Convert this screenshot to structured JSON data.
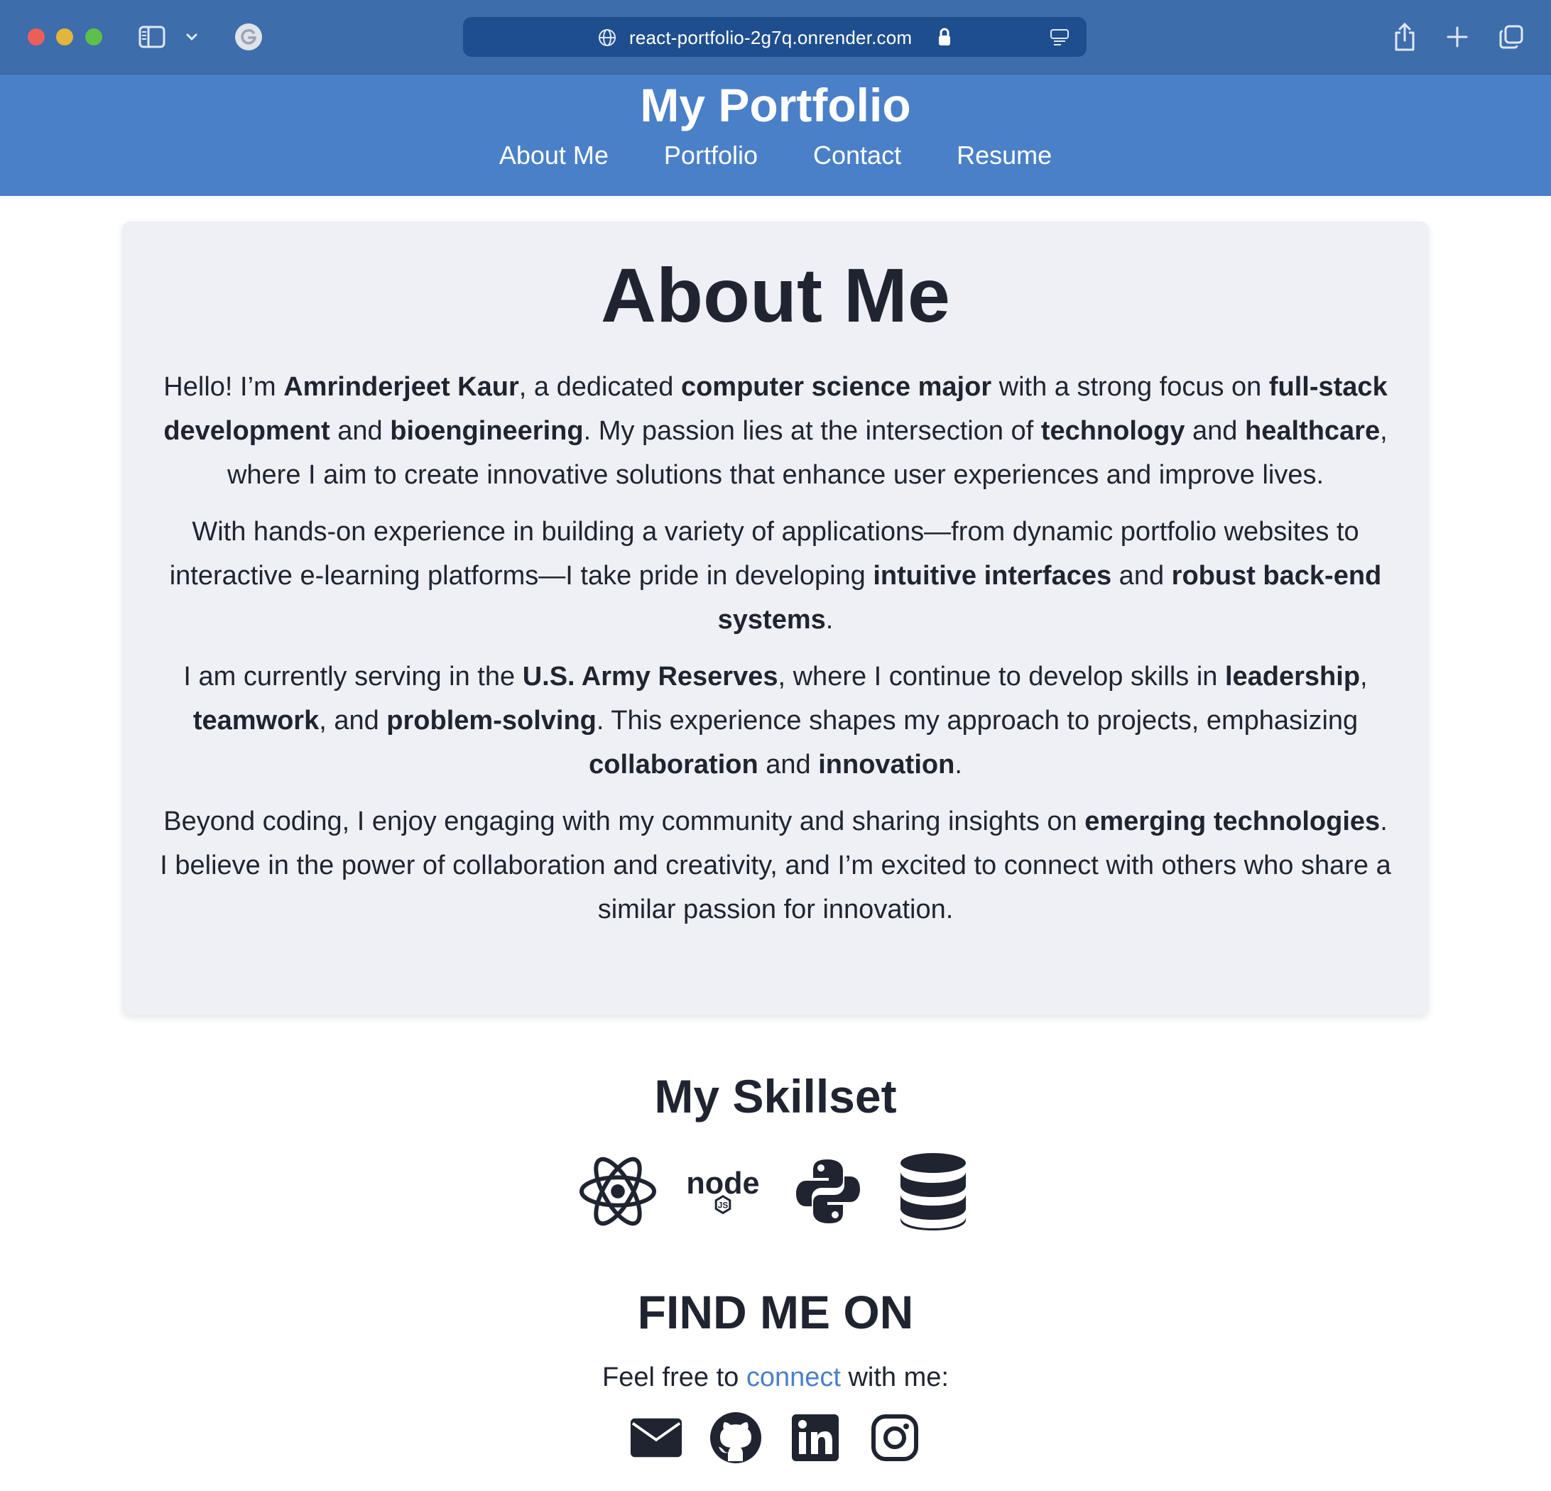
{
  "browser": {
    "url": "react-portfolio-2g7q.onrender.com"
  },
  "header": {
    "title": "My Portfolio",
    "nav": [
      "About Me",
      "Portfolio",
      "Contact",
      "Resume"
    ]
  },
  "about": {
    "heading": "About Me",
    "p1": {
      "a": "Hello! I’m ",
      "b": "Amrinderjeet Kaur",
      "c": ", a dedicated ",
      "d": "computer science major",
      "e": " with a strong focus on ",
      "f": "full-stack development",
      "g": " and ",
      "h": "bioengineering",
      "i": ". My passion lies at the intersection of ",
      "j": "technology",
      "k": " and ",
      "l": "healthcare",
      "m": ", where I aim to create innovative solutions that enhance user experiences and improve lives."
    },
    "p2": {
      "a": "With hands-on experience in building a variety of applications—from dynamic portfolio websites to interactive e-learning platforms—I take pride in developing ",
      "b": "intuitive interfaces",
      "c": " and ",
      "d": "robust back-end systems",
      "e": "."
    },
    "p3": {
      "a": "I am currently serving in the ",
      "b": "U.S. Army Reserves",
      "c": ", where I continue to develop skills in ",
      "d": "leadership",
      "e": ", ",
      "f": "teamwork",
      "g": ", and ",
      "h": "problem-solving",
      "i": ". This experience shapes my approach to projects, emphasizing ",
      "j": "collaboration",
      "k": " and ",
      "l": "innovation",
      "m": "."
    },
    "p4": {
      "a": "Beyond coding, I enjoy engaging with my community and sharing insights on ",
      "b": "emerging technologies",
      "c": ". I believe in the power of collaboration and creativity, and I’m excited to connect with others who share a similar passion for innovation."
    }
  },
  "skills": {
    "heading": "My Skillset",
    "icons": [
      "react-icon",
      "nodejs-icon",
      "python-icon",
      "database-icon"
    ]
  },
  "find": {
    "heading": "FIND ME ON",
    "sub_before": "Feel free to ",
    "sub_link": "connect",
    "sub_after": " with me:",
    "icons": [
      "email-icon",
      "github-icon",
      "linkedin-icon",
      "instagram-icon"
    ]
  },
  "colors": {
    "chrome": "#3d6dab",
    "header": "#4a80c8",
    "card": "#eef0f5",
    "text": "#1f2430",
    "link": "#4a80c8"
  }
}
